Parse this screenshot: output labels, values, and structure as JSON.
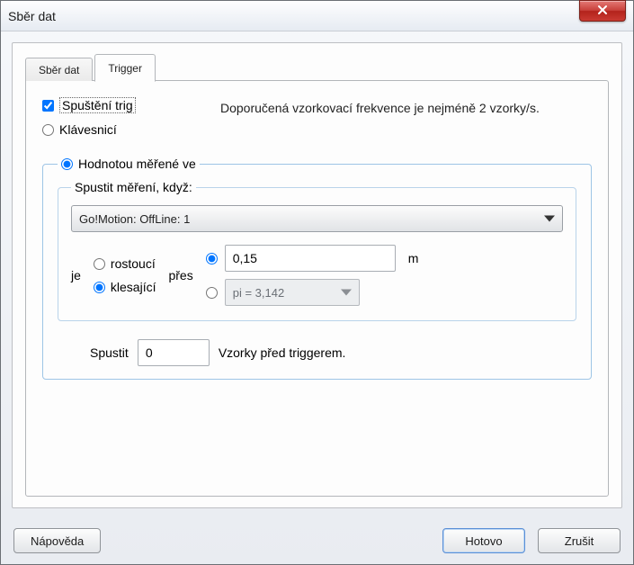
{
  "window": {
    "title": "Sběr dat"
  },
  "tabs": {
    "data": "Sběr dat",
    "trigger": "Trigger",
    "active": "trigger"
  },
  "trigger": {
    "enable_label": "Spuštění trig",
    "enable_checked": true,
    "hint": "Doporučená vzorkovací frekvence je nejméně 2 vzorky/s.",
    "by_keyboard_label": "Klávesnicí",
    "by_value_label": "Hodnotou měřené ve",
    "mode_selected": "by_value",
    "start_when_label": "Spustit měření, když:",
    "channel_selected": "Go!Motion: OffLine: 1",
    "je_label": "je",
    "rising_label": "rostoucí",
    "falling_label": "klesající",
    "direction_selected": "falling",
    "pres_label": "přes",
    "threshold_mode": "numeric",
    "threshold_numeric": "0,15",
    "threshold_constant": "pi = 3,142",
    "unit": "m",
    "pretrigger_prefix": "Spustit",
    "pretrigger_value": "0",
    "pretrigger_suffix": "Vzorky před triggerem."
  },
  "buttons": {
    "help": "Nápověda",
    "ok": "Hotovo",
    "cancel": "Zrušit"
  }
}
